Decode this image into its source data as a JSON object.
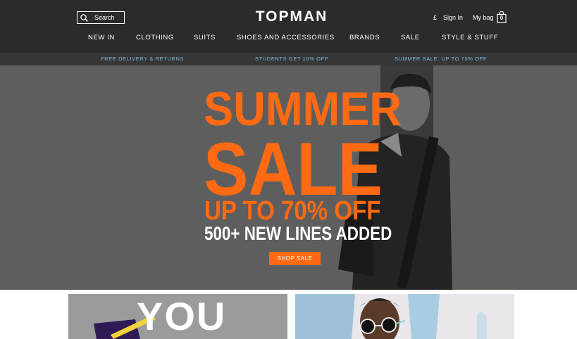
{
  "header": {
    "search_label": "Search",
    "search_placeholder": "Search",
    "logo": "TOPMAN",
    "currency": "£",
    "sign_in": "Sign In",
    "my_bag": "My bag",
    "bag_count": "0",
    "search_icon": "search-icon",
    "bag_icon": "shopping-bag-icon"
  },
  "nav": [
    "NEW IN",
    "CLOTHING",
    "SUITS",
    "SHOES AND ACCESSORIES",
    "BRANDS",
    "SALE",
    "STYLE & STUFF"
  ],
  "promo": [
    "FREE DELIVERY & RETURNS",
    "STUDENTS GET 10% OFF",
    "SUMMER SALE: UP TO 70% OFF"
  ],
  "hero": {
    "line1": "SUMMER",
    "line2": "SALE",
    "line3": "UP TO 70% OFF",
    "line4": "500+ NEW LINES ADDED",
    "cta": "SHOP SALE"
  },
  "tiles": {
    "left_text": "YOU"
  },
  "colors": {
    "header_bg": "#2b2b2b",
    "promo_bg": "#363636",
    "promo_text": "#7fb6d8",
    "accent": "#ff6a13",
    "hero_bg": "#5e5e5e"
  }
}
